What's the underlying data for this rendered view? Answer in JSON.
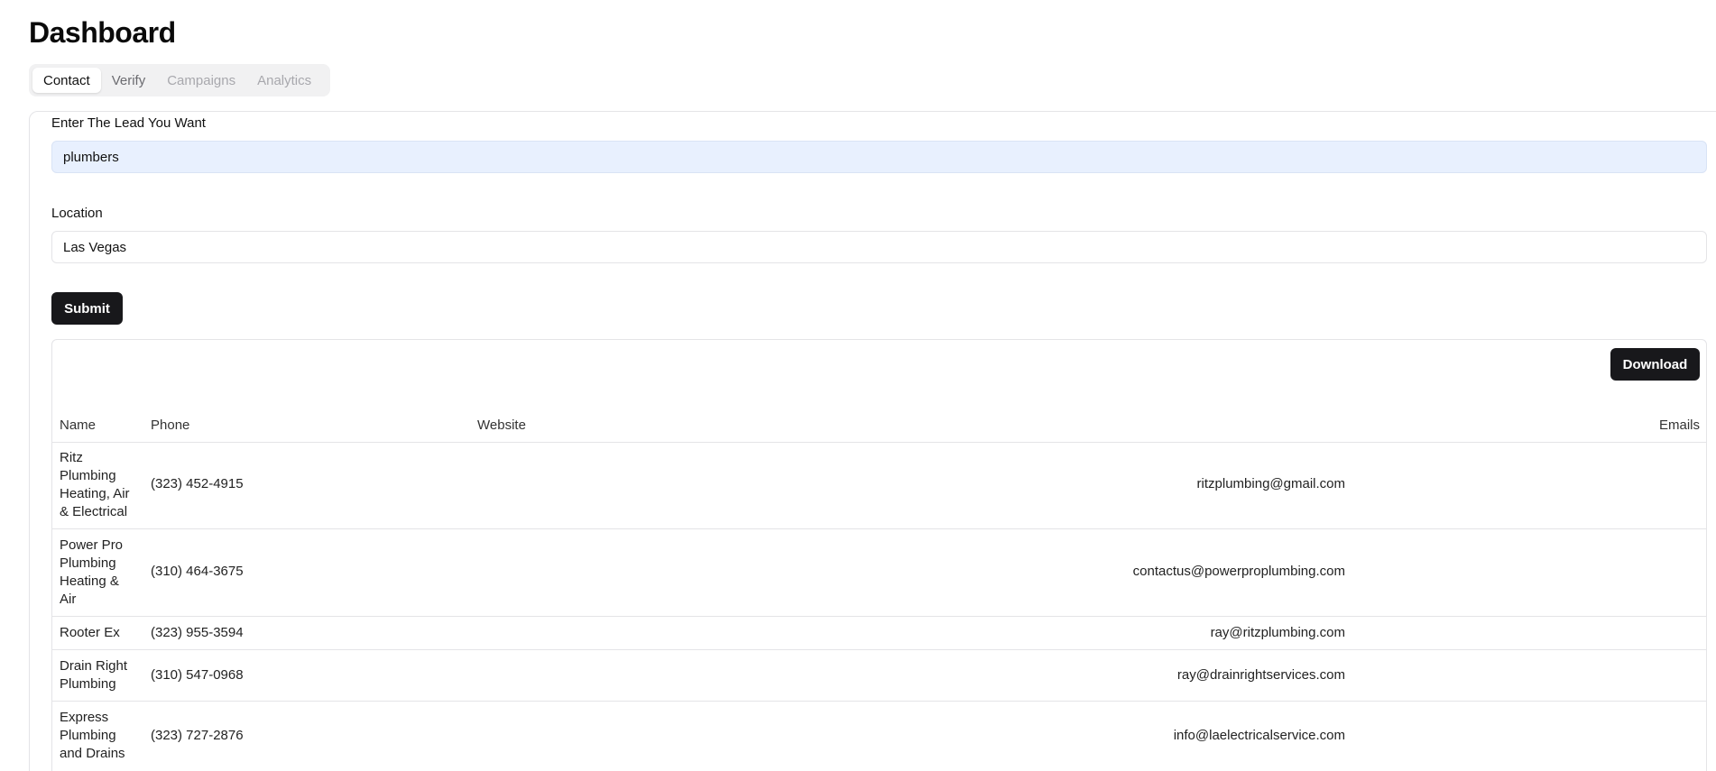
{
  "header": {
    "title": "Dashboard"
  },
  "tabs": [
    {
      "label": "Contact",
      "state": "active"
    },
    {
      "label": "Verify",
      "state": "normal"
    },
    {
      "label": "Campaigns",
      "state": "disabled"
    },
    {
      "label": "Analytics",
      "state": "disabled"
    }
  ],
  "form": {
    "lead_label": "Enter The Lead You Want",
    "lead_value": "plumbers",
    "location_label": "Location",
    "location_value": "Las Vegas",
    "submit_label": "Submit"
  },
  "results": {
    "download_label": "Download",
    "columns": {
      "name": "Name",
      "phone": "Phone",
      "website": "Website",
      "emails": "Emails"
    },
    "rows": [
      {
        "name": "Ritz Plumbing Heating, Air & Electrical",
        "phone": "(323) 452-4915",
        "website": "",
        "email": "ritzplumbing@gmail.com"
      },
      {
        "name": "Power Pro Plumbing Heating & Air",
        "phone": "(310) 464-3675",
        "website": "",
        "email": "contactus@powerproplumbing.com"
      },
      {
        "name": "Rooter Ex",
        "phone": "(323) 955-3594",
        "website": "",
        "email": "ray@ritzplumbing.com"
      },
      {
        "name": "Drain Right Plumbing",
        "phone": "(310) 547-0968",
        "website": "",
        "email": "ray@drainrightservices.com"
      },
      {
        "name": "Express Plumbing and Drains",
        "phone": "(323) 727-2876",
        "website": "",
        "email": "info@laelectricalservice.com"
      }
    ]
  },
  "colors": {
    "primary_button": "#18181b",
    "autofill_bg": "#e8f0fe",
    "border": "#e4e4e7",
    "tab_bg": "#f1f1f2"
  }
}
